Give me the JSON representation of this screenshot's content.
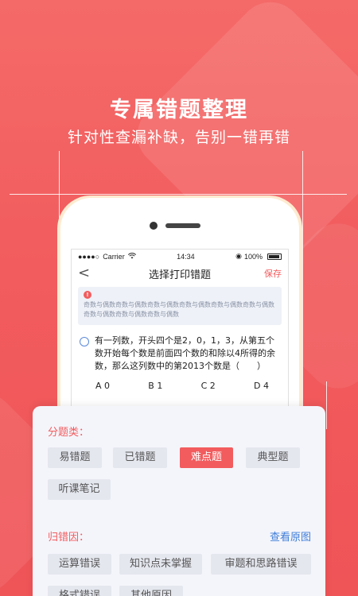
{
  "promo": {
    "headline": "专属错题整理",
    "subline": "针对性查漏补缺，告别一错再错"
  },
  "phone": {
    "status": {
      "signal": "●●●●○",
      "carrier": "Carrier",
      "wifi": "wifi-icon",
      "time": "14:34",
      "battery_pct": "100%"
    },
    "nav": {
      "back": "<",
      "title": "选择打印错题",
      "save": "保存"
    },
    "notice": {
      "icon": "!",
      "text": "奇数与偶数奇数与偶数奇数与偶数奇数与偶数奇数与偶数奇数与偶数奇数与偶数奇数与偶数奇数与偶数"
    },
    "question": {
      "text": "有一列数，开头四个是2，0，1，3，从第五个数开始每个数是前面四个数的和除以4所得的余数，那么这列数中的第2013个数是（　　）",
      "options": [
        "A 0",
        "B 1",
        "C 2",
        "D 4"
      ]
    }
  },
  "sheet": {
    "category_label": "分题类：",
    "categories": [
      {
        "label": "易错题",
        "active": false
      },
      {
        "label": "已错题",
        "active": false
      },
      {
        "label": "难点题",
        "active": true
      },
      {
        "label": "典型题",
        "active": false
      },
      {
        "label": "听课笔记",
        "active": false
      }
    ],
    "reason_label": "归错因：",
    "view_original": "查看原图",
    "reasons": [
      {
        "label": "运算错误"
      },
      {
        "label": "知识点未掌握"
      },
      {
        "label": "审题和思路错误"
      },
      {
        "label": "格式错误"
      },
      {
        "label": "其他原因"
      }
    ]
  },
  "colors": {
    "brand_red": "#f25c5e",
    "link_blue": "#3f7ed9",
    "chip_bg": "#e5e7ef"
  }
}
